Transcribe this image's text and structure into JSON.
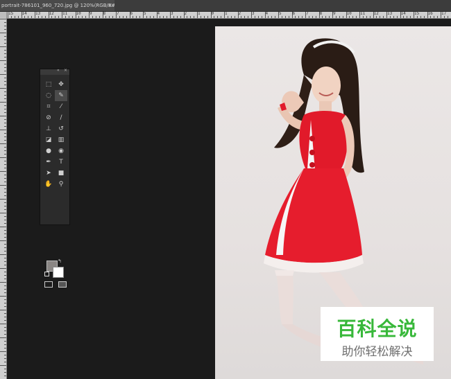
{
  "document_tab": {
    "title": "portrait-786101_960_720.jpg @ 120%(RGB/8#)",
    "close_glyph": "×"
  },
  "ruler_top_labels": [
    "15",
    "14",
    "13",
    "12",
    "11",
    "10",
    "9",
    "8",
    "7",
    "6",
    "5",
    "4",
    "3",
    "2",
    "1",
    "0",
    "1",
    "2",
    "3",
    "4",
    "5",
    "6",
    "7",
    "8",
    "9",
    "10",
    "11",
    "12",
    "13",
    "14",
    "15",
    "16",
    "17"
  ],
  "tools_panel": {
    "collapse_glyph": "«",
    "close_glyph": "×",
    "tools": [
      {
        "name": "marquee-tool-icon",
        "glyph": "⬚"
      },
      {
        "name": "move-tool-icon",
        "glyph": "✥"
      },
      {
        "name": "lasso-tool-icon",
        "glyph": "◌"
      },
      {
        "name": "quick-selection-tool-icon",
        "glyph": "✎",
        "active": true
      },
      {
        "name": "crop-tool-icon",
        "glyph": "⌗"
      },
      {
        "name": "eyedropper-tool-icon",
        "glyph": "⁄"
      },
      {
        "name": "healing-brush-tool-icon",
        "glyph": "⊘"
      },
      {
        "name": "brush-tool-icon",
        "glyph": "/"
      },
      {
        "name": "clone-stamp-tool-icon",
        "glyph": "⊥"
      },
      {
        "name": "history-brush-tool-icon",
        "glyph": "↺"
      },
      {
        "name": "eraser-tool-icon",
        "glyph": "◪"
      },
      {
        "name": "gradient-tool-icon",
        "glyph": "▥"
      },
      {
        "name": "blur-tool-icon",
        "glyph": "●"
      },
      {
        "name": "dodge-tool-icon",
        "glyph": "◉"
      },
      {
        "name": "pen-tool-icon",
        "glyph": "✒"
      },
      {
        "name": "type-tool-icon",
        "glyph": "T"
      },
      {
        "name": "path-selection-tool-icon",
        "glyph": "➤"
      },
      {
        "name": "shape-tool-icon",
        "glyph": "■"
      },
      {
        "name": "hand-tool-icon",
        "glyph": "✋"
      },
      {
        "name": "zoom-tool-icon",
        "glyph": "⚲"
      }
    ],
    "foreground_color": "#8a8684",
    "background_color": "#ffffff"
  },
  "watermark": {
    "title": "百科全说",
    "subtitle": "助你轻松解决",
    "title_color": "#38b83a"
  },
  "colors": {
    "workspace": "#1b1b1b",
    "dress": "#e11a2a",
    "backdrop": "#e9e5e4"
  }
}
